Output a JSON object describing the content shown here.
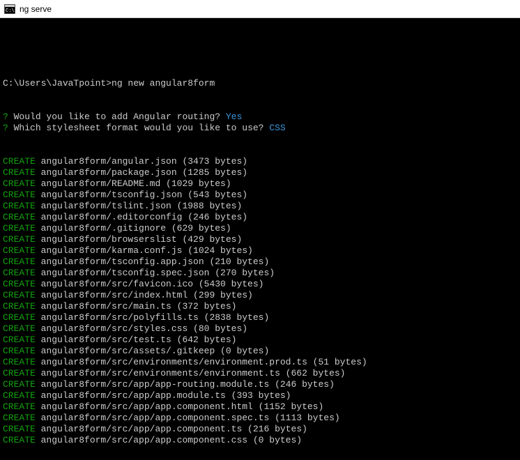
{
  "titlebar": {
    "title": "ng serve"
  },
  "prompt": {
    "path": "C:\\Users\\JavaTpoint>",
    "command": "ng new angular8form"
  },
  "questions": [
    {
      "mark": "?",
      "text": " Would you like to add Angular routing? ",
      "answer": "Yes"
    },
    {
      "mark": "?",
      "text": " Which stylesheet format would you like to use? ",
      "answer": "CSS"
    }
  ],
  "creates": [
    {
      "label": "CREATE",
      "path": " angular8form/angular.json (3473 bytes)"
    },
    {
      "label": "CREATE",
      "path": " angular8form/package.json (1285 bytes)"
    },
    {
      "label": "CREATE",
      "path": " angular8form/README.md (1029 bytes)"
    },
    {
      "label": "CREATE",
      "path": " angular8form/tsconfig.json (543 bytes)"
    },
    {
      "label": "CREATE",
      "path": " angular8form/tslint.json (1988 bytes)"
    },
    {
      "label": "CREATE",
      "path": " angular8form/.editorconfig (246 bytes)"
    },
    {
      "label": "CREATE",
      "path": " angular8form/.gitignore (629 bytes)"
    },
    {
      "label": "CREATE",
      "path": " angular8form/browserslist (429 bytes)"
    },
    {
      "label": "CREATE",
      "path": " angular8form/karma.conf.js (1024 bytes)"
    },
    {
      "label": "CREATE",
      "path": " angular8form/tsconfig.app.json (210 bytes)"
    },
    {
      "label": "CREATE",
      "path": " angular8form/tsconfig.spec.json (270 bytes)"
    },
    {
      "label": "CREATE",
      "path": " angular8form/src/favicon.ico (5430 bytes)"
    },
    {
      "label": "CREATE",
      "path": " angular8form/src/index.html (299 bytes)"
    },
    {
      "label": "CREATE",
      "path": " angular8form/src/main.ts (372 bytes)"
    },
    {
      "label": "CREATE",
      "path": " angular8form/src/polyfills.ts (2838 bytes)"
    },
    {
      "label": "CREATE",
      "path": " angular8form/src/styles.css (80 bytes)"
    },
    {
      "label": "CREATE",
      "path": " angular8form/src/test.ts (642 bytes)"
    },
    {
      "label": "CREATE",
      "path": " angular8form/src/assets/.gitkeep (0 bytes)"
    },
    {
      "label": "CREATE",
      "path": " angular8form/src/environments/environment.prod.ts (51 bytes)"
    },
    {
      "label": "CREATE",
      "path": " angular8form/src/environments/environment.ts (662 bytes)"
    },
    {
      "label": "CREATE",
      "path": " angular8form/src/app/app-routing.module.ts (246 bytes)"
    },
    {
      "label": "CREATE",
      "path": " angular8form/src/app/app.module.ts (393 bytes)"
    },
    {
      "label": "CREATE",
      "path": " angular8form/src/app/app.component.html (1152 bytes)"
    },
    {
      "label": "CREATE",
      "path": " angular8form/src/app/app.component.spec.ts (1113 bytes)"
    },
    {
      "label": "CREATE",
      "path": " angular8form/src/app/app.component.ts (216 bytes)"
    },
    {
      "label": "CREATE",
      "path": " angular8form/src/app/app.component.css (0 bytes)"
    }
  ]
}
